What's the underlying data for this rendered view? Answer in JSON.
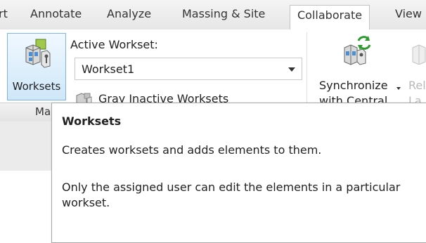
{
  "ribbon_tabs": [
    "rt",
    "Annotate",
    "Analyze",
    "Massing & Site",
    "Collaborate",
    "View"
  ],
  "active_tab": "Collaborate",
  "worksets_panel": {
    "worksets_button_label": "Worksets",
    "active_workset_label": "Active Workset:",
    "active_workset_value": "Workset1",
    "gray_inactive_label": "Gray Inactive Worksets",
    "panel_label": "Ma"
  },
  "synchronize_panel": {
    "synchronize_line1": "Synchronize",
    "synchronize_line2": "with Central",
    "reload_line1": "Rel",
    "reload_line2": "La"
  },
  "tooltip": {
    "title": "Worksets",
    "description": "Creates worksets and adds elements to them.",
    "detail_line1": "Only the assigned user can edit the elements in a particular",
    "detail_line2": "workset."
  },
  "colors": {
    "selected_button_fill": "#cfe7f8",
    "selected_button_border": "#7eb4ea",
    "sync_arrow_green": "#2e9a2e",
    "disabled_text": "#b9b9b9"
  },
  "icons": {
    "worksets": "worksets-icon",
    "gray_inactive": "gray-worksets-icon",
    "synchronize": "synchronize-icon",
    "reload": "reload-latest-icon"
  }
}
